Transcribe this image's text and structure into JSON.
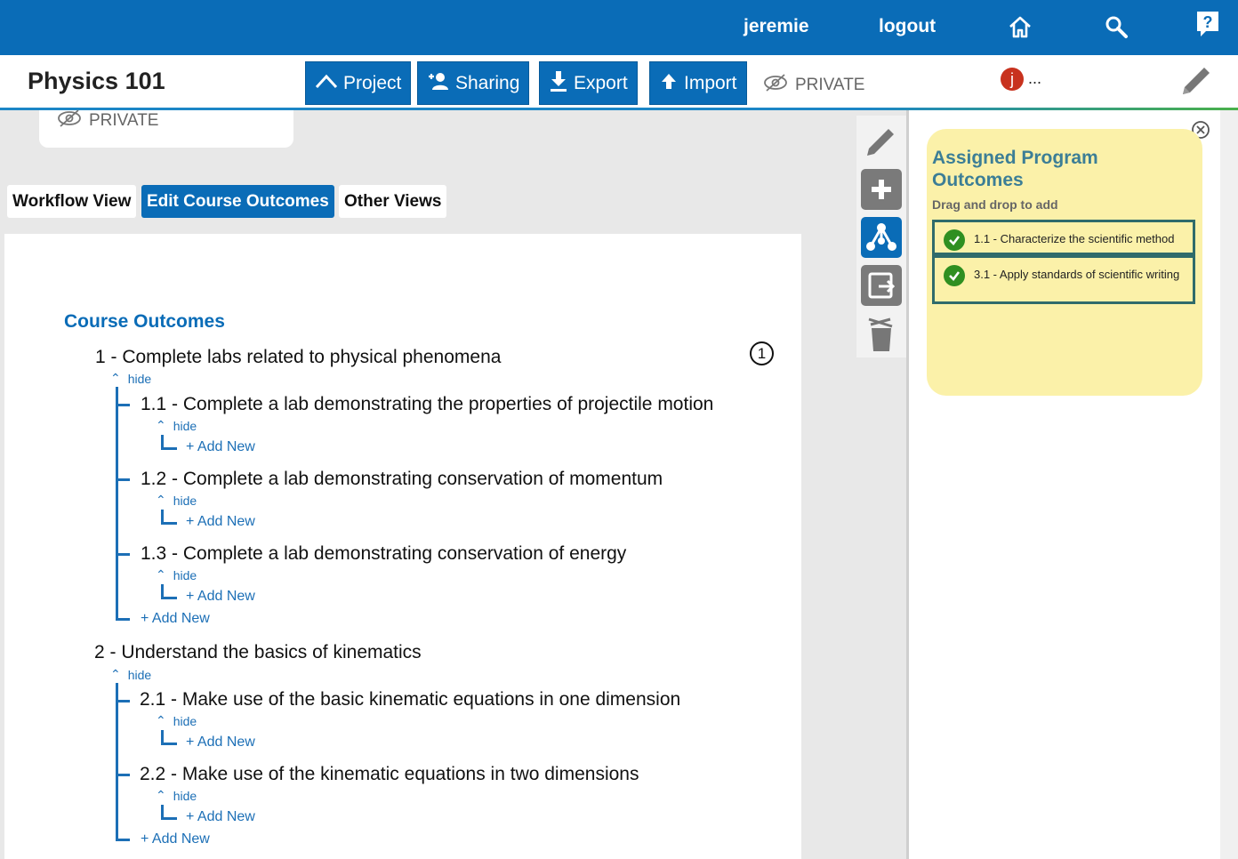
{
  "topbar": {
    "username": "jeremie",
    "logout_label": "logout",
    "icons": [
      "home-icon",
      "search-icon",
      "help-icon"
    ],
    "bg_color": "#0a6cb7"
  },
  "header": {
    "title": "Physics 101",
    "buttons": {
      "project": "Project",
      "sharing": "Sharing",
      "export": "Export",
      "import": "Import"
    },
    "privacy_label": "PRIVATE",
    "avatar_initial": "j",
    "avatar_more": "..."
  },
  "card": {
    "privacy_label": "PRIVATE"
  },
  "tabs": [
    {
      "label": "Workflow View"
    },
    {
      "label": "Edit Course Outcomes"
    },
    {
      "label": "Other Views"
    }
  ],
  "main": {
    "section_title": "Course Outcomes",
    "marker": "1",
    "outcomes": [
      {
        "label": "1 - Complete labs related to physical phenomena",
        "hide": "hide",
        "children": [
          {
            "label": "1.1 - Complete a lab demonstrating the properties of projectile motion",
            "hide": "hide",
            "add": "+ Add New"
          },
          {
            "label": "1.2 - Complete a lab demonstrating conservation of momentum",
            "hide": "hide",
            "add": "+ Add New"
          },
          {
            "label": "1.3 - Complete a lab demonstrating conservation of energy",
            "hide": "hide",
            "add": "+ Add New"
          }
        ],
        "add": "+ Add New"
      },
      {
        "label": "2 - Understand the basics of kinematics",
        "hide": "hide",
        "children": [
          {
            "label": "2.1 - Make use of the basic kinematic equations in one dimension",
            "hide": "hide",
            "add": "+ Add New"
          },
          {
            "label": "2.2 - Make use of the kinematic equations in two dimensions",
            "hide": "hide",
            "add": "+ Add New"
          }
        ],
        "add": "+ Add New"
      }
    ]
  },
  "side_tools": [
    "pencil-icon",
    "add-icon",
    "outcomes-graph-icon",
    "export-icon",
    "trash-icon"
  ],
  "right_panel": {
    "title": "Assigned Program Outcomes",
    "subtitle": "Drag and drop to add",
    "items": [
      {
        "label": "1.1 - Characterize the scientific method"
      },
      {
        "label": "3.1 - Apply standards of scientific writing"
      }
    ]
  }
}
